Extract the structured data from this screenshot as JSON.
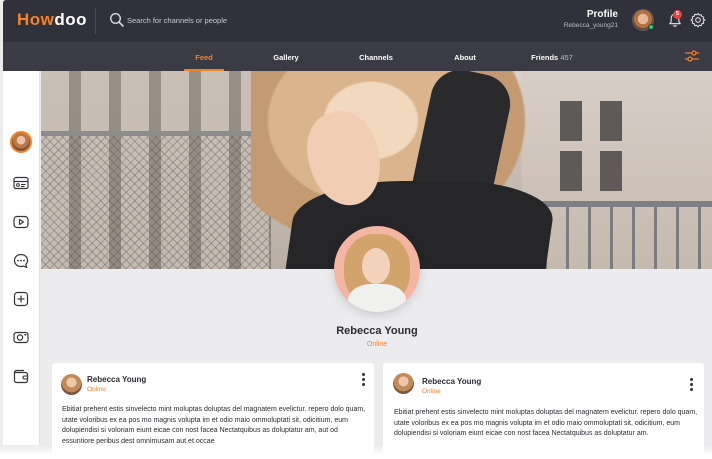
{
  "app": {
    "logo": {
      "prefix": "H",
      "mid": "ow",
      "oo": "doo"
    },
    "search": {
      "placeholder": "Search for channels or people"
    },
    "profile": {
      "title": "Profile",
      "username": "Rebecca_young21"
    },
    "notifications": {
      "count": "5"
    }
  },
  "nav": {
    "tabs": [
      {
        "label": "Feed",
        "active": true
      },
      {
        "label": "Gallery"
      },
      {
        "label": "Channels"
      },
      {
        "label": "About"
      },
      {
        "label": "Friends",
        "count": "457"
      }
    ]
  },
  "sidebar": {
    "items": [
      {
        "icon": "user-avatar"
      },
      {
        "icon": "id-card-icon"
      },
      {
        "icon": "video-play-icon"
      },
      {
        "icon": "chat-bubble-icon"
      },
      {
        "icon": "add-square-icon"
      },
      {
        "icon": "camera-icon"
      },
      {
        "icon": "wallet-icon"
      }
    ]
  },
  "user": {
    "name": "Rebecca Young",
    "status": "Online"
  },
  "posts": [
    {
      "author": "Rebecca Young",
      "status": "Online",
      "text": "Ebitiat prehent estis sinvelecto mint moluptas doluptas del magnatem evelictur. repero dolo quam, utate voloribus ex ea pos mo magnis volupta im et odio maio ommoluptati sit, odicitium, eum dolupiendisi si voloriam eiunt eicae con nost facea Nectatquibus as doluptatur am, aut od essuntiore peribus dest omnimusam aut et occae"
    },
    {
      "author": "Rebecca Young",
      "status": "Online",
      "text": "Ebitiat prehent estis sinvelecto mint moluptas doluptas del magnatem evelictur. repero dolo quam, utate voloribus ex ea pos mo magnis volupta im et odio maio ommoluptati sit, odicitium, eum dolupiendisi si voloriam eiunt eicae con nost facea Nectatquibus as doluptatur am."
    }
  ],
  "colors": {
    "accent": "#f5822a",
    "topbar": "#30313a",
    "navbar": "#3a3b44",
    "online": "#2ecc71",
    "badge": "#e8403e"
  }
}
